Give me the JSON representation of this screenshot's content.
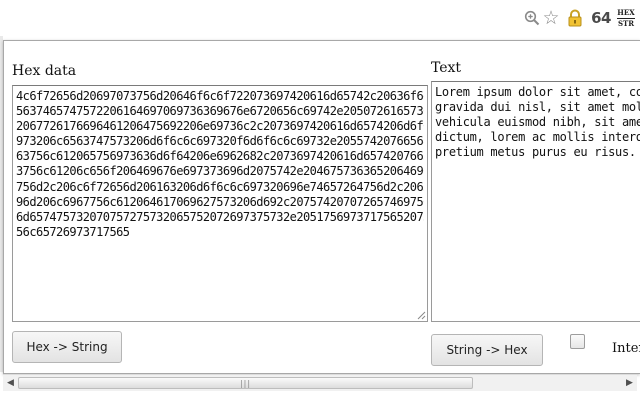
{
  "toolbar": {
    "icons": [
      "zoom-icon",
      "star-icon",
      "lock-icon",
      "extension-64-icon",
      "hex-str-extension-icon"
    ],
    "ext64_label": "64",
    "hexstr_top": "HEX",
    "hexstr_bottom": "STR"
  },
  "popup": {
    "hex_label": "Hex data",
    "text_label": "Text",
    "hex_value": "4c6f72656d20697073756d20646f6c6f722073697420616d65742c20636f6e7365637465747572206164697069736369676e6720656c69742e205072616573656e74206772617669646120647569206e69736c2c2073697420616d6574206d6f6c6c6973206c6563747573206d6f6c6c69732e2055742076656869637563756c61206575697367697373756d206e696268207369742073697420616d6574207665686963756c61206575697373696f6e2077746f2047757673636520646963747574756d2c206c6f72656d206163206d6f6c6c697320696e74657264756d2c20656e696d206e6967756c612066617563696275732073656d206964206e756c6c612070726574697573206d65747573207075727573206575207269737573",
    "hex_lines": [
      "4c6f72656d20697073756d20646f6c6f722073697420616d65742c20636f6e736",
      "5637465747572206164697069736369676e6720656c69742e205072616573656e74",
      "2067726176696461206475692206e69736c2c2073697420616d6574206d6f6c6c6",
      "973206c6563747573206d6f6c6c697320f6d6f6c6c69732e2055742076656869",
      "63756c612065756973636d6f64206e6962682c2073697420616d65742076656869",
      "3756c61206c656f206469676e697373696d2075742e2046757363652064696374",
      "756d2c206c6f72656d206163206d6f6c6c697320696e74657264756d2c20656e6",
      "96d206c6967756c612064617069627573206d692c20757420707265746975 6d20",
      "6d65747573207075727573206575207269737573 2e20517569737175652073636",
      "56c65726973717565"
    ],
    "text_value": "Lorem ipsum dolor sit amet, cons\ngravida dui nisl, sit amet molli\nvehicula euismod nibh, sit amet \ndictum, lorem ac mollis interdum\npretium metus purus eu risus. Qu",
    "hex_to_string_button": "Hex -> String",
    "string_to_hex_button": "String -> Hex",
    "inter_label": "Inter",
    "inter_checked": false
  },
  "scrollbar": {
    "left_arrow": "◀",
    "right_arrow": "▶",
    "thumb_grip": "|||"
  }
}
